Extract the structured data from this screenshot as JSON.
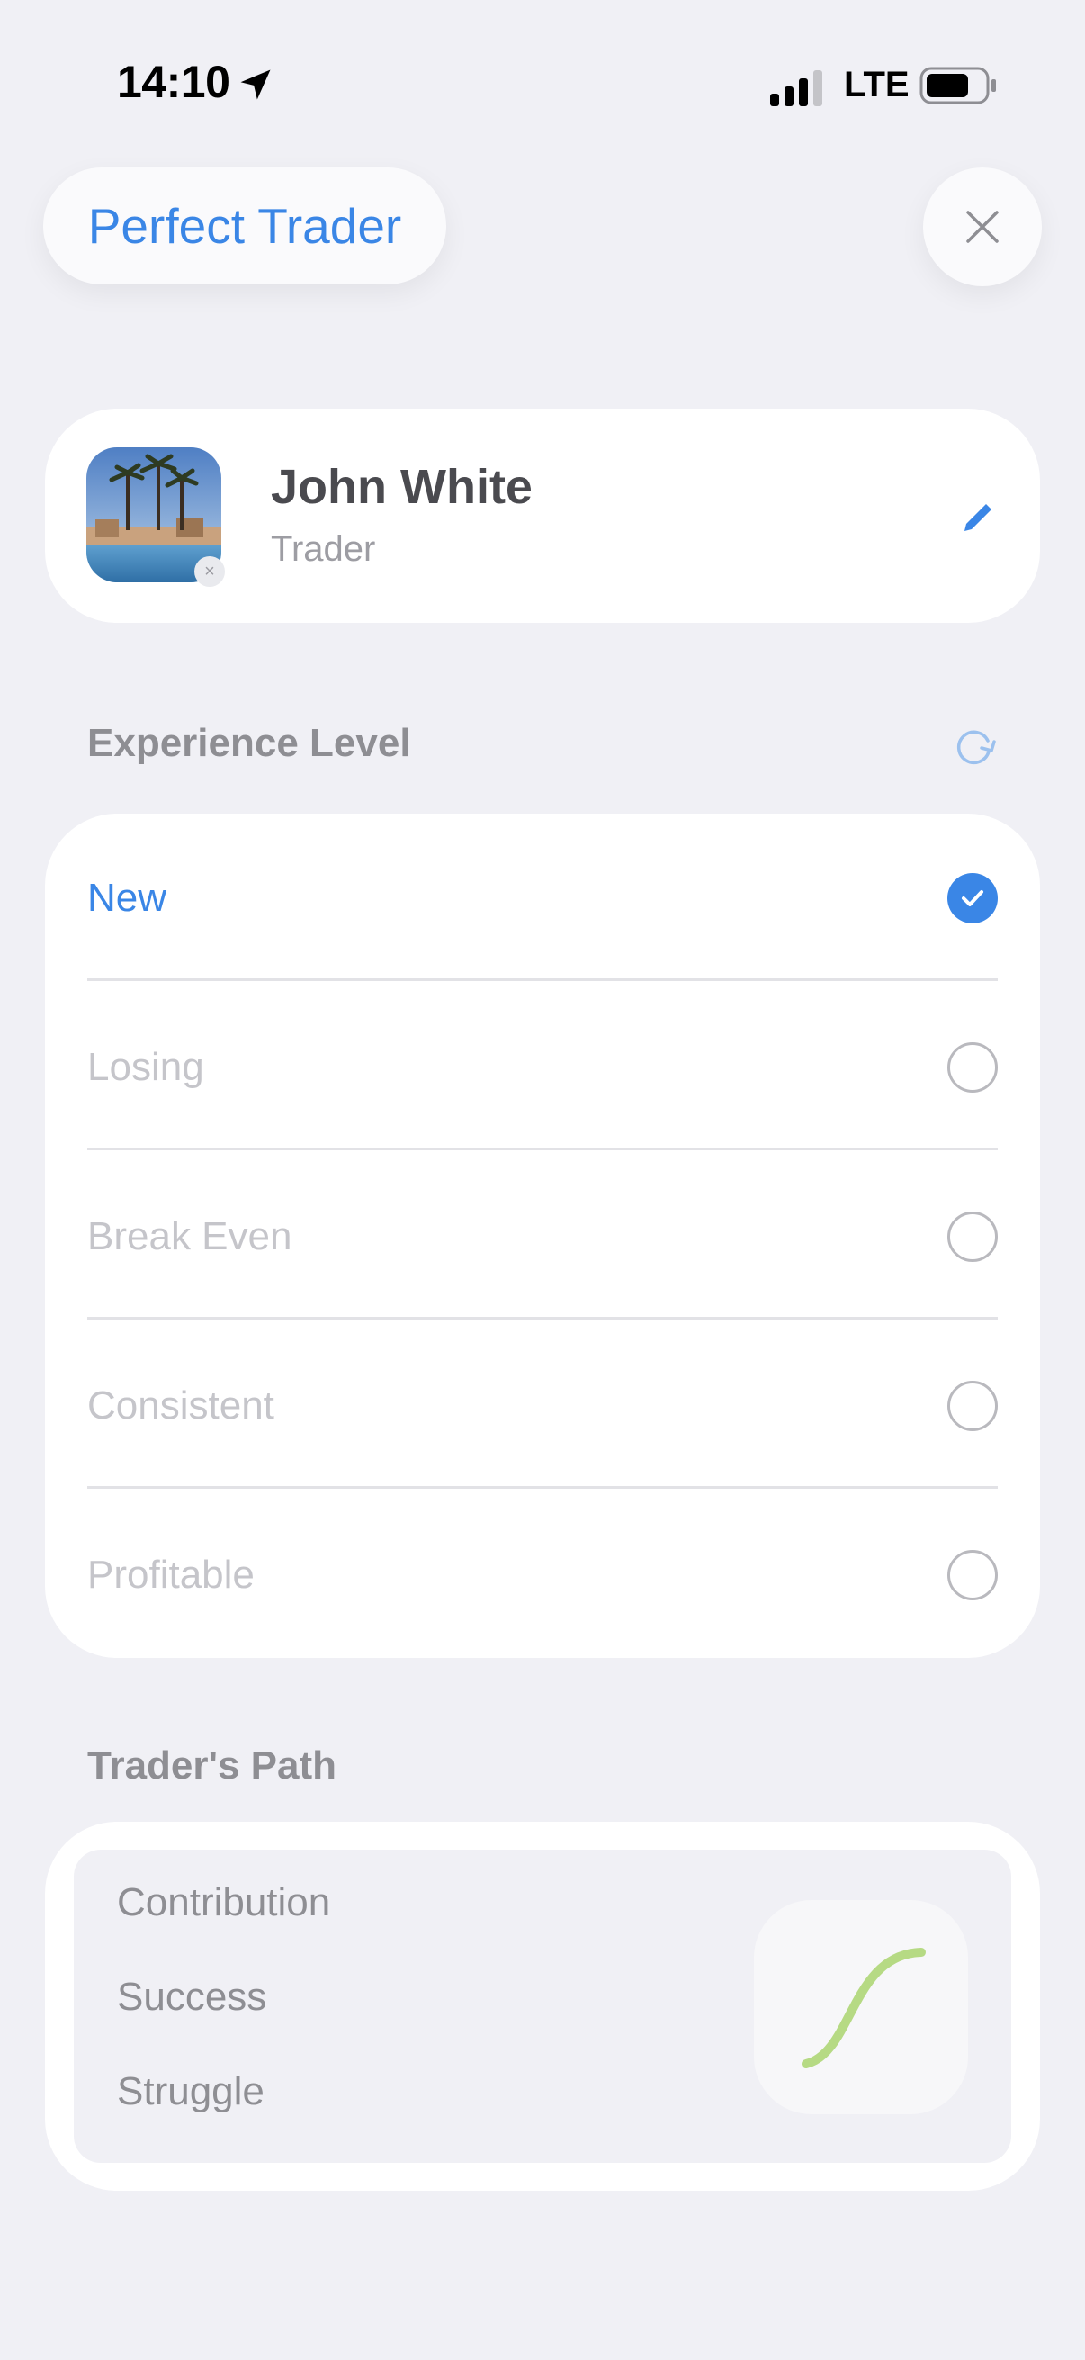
{
  "status_bar": {
    "time": "14:10",
    "network": "LTE"
  },
  "header": {
    "title": "Perfect Trader",
    "close_icon": "close-icon"
  },
  "profile": {
    "name": "John White",
    "role": "Trader",
    "edit_icon": "pencil-icon"
  },
  "experience": {
    "title": "Experience Level",
    "refresh_icon": "refresh-icon",
    "options": [
      {
        "label": "New",
        "selected": true
      },
      {
        "label": "Losing",
        "selected": false
      },
      {
        "label": "Break Even",
        "selected": false
      },
      {
        "label": "Consistent",
        "selected": false
      },
      {
        "label": "Profitable",
        "selected": false
      }
    ]
  },
  "path": {
    "title": "Trader's Path",
    "items": [
      "Contribution",
      "Success",
      "Struggle"
    ],
    "curve_color": "#b6da84"
  },
  "colors": {
    "accent": "#3a86e6",
    "background": "#f0f0f5"
  }
}
